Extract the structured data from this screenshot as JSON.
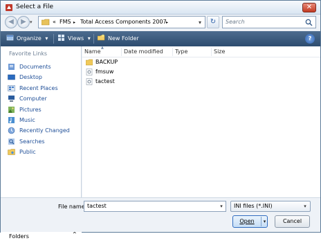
{
  "window": {
    "title": "Select a File",
    "close_glyph": "✕"
  },
  "nav": {
    "back_glyph": "◀",
    "forward_glyph": "▶",
    "history_glyph": "▾",
    "address": {
      "overflow": "«",
      "crumbs": [
        "FMS",
        "Total Access Components 2007"
      ],
      "separator": "▸",
      "dropdown_glyph": "▾"
    },
    "refresh_glyph": "↻",
    "search": {
      "placeholder": "Search"
    }
  },
  "toolbar": {
    "organize_label": "Organize",
    "views_label": "Views",
    "new_folder_label": "New Folder",
    "dropdown_glyph": "▾",
    "help_glyph": "?"
  },
  "sidebar": {
    "header": "Favorite Links",
    "items": [
      {
        "label": "Documents",
        "icon": "documents-icon"
      },
      {
        "label": "Desktop",
        "icon": "desktop-icon"
      },
      {
        "label": "Recent Places",
        "icon": "recent-places-icon"
      },
      {
        "label": "Computer",
        "icon": "computer-icon"
      },
      {
        "label": "Pictures",
        "icon": "pictures-icon"
      },
      {
        "label": "Music",
        "icon": "music-icon"
      },
      {
        "label": "Recently Changed",
        "icon": "recently-changed-icon"
      },
      {
        "label": "Searches",
        "icon": "searches-icon"
      },
      {
        "label": "Public",
        "icon": "public-icon"
      }
    ],
    "folders_label": "Folders",
    "folders_chevron": "⌃"
  },
  "files": {
    "columns": [
      "Name",
      "Date modified",
      "Type",
      "Size"
    ],
    "sort_caret": "▲",
    "rows": [
      {
        "name": "BACKUP",
        "kind": "folder"
      },
      {
        "name": "fmsuw",
        "kind": "ini"
      },
      {
        "name": "tactest",
        "kind": "ini"
      }
    ]
  },
  "bottom": {
    "file_name_label": "File name:",
    "file_name_value": "tactest",
    "file_type_value": "INI files (*.INI)",
    "open_label": "Open",
    "cancel_label": "Cancel",
    "dropdown_glyph": "▾"
  },
  "colors": {
    "toolbar_bg": "#3d5c80",
    "link_blue": "#1e4e97",
    "accent_blue": "#2f6bbf"
  }
}
